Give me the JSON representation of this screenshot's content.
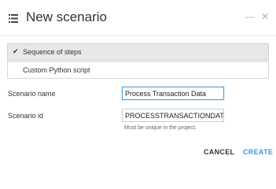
{
  "dialog": {
    "title": "New scenario",
    "icon": "list-icon",
    "minimize_glyph": "—",
    "close_glyph": "✕"
  },
  "type_options": [
    {
      "label": "Sequence of steps",
      "selected": true,
      "check_glyph": "✔"
    },
    {
      "label": "Custom Python script",
      "selected": false
    }
  ],
  "form": {
    "name_label": "Scenario name",
    "name_value": "Process Transaction Data",
    "id_label": "Scenario id",
    "id_value": "PROCESSTRANSACTIONDATA",
    "id_hint": "Must be unique in the project."
  },
  "footer": {
    "cancel_label": "CANCEL",
    "create_label": "CREATE"
  },
  "colors": {
    "accent": "#3b99e0",
    "selected_option_bg": "#e8e8e8"
  }
}
